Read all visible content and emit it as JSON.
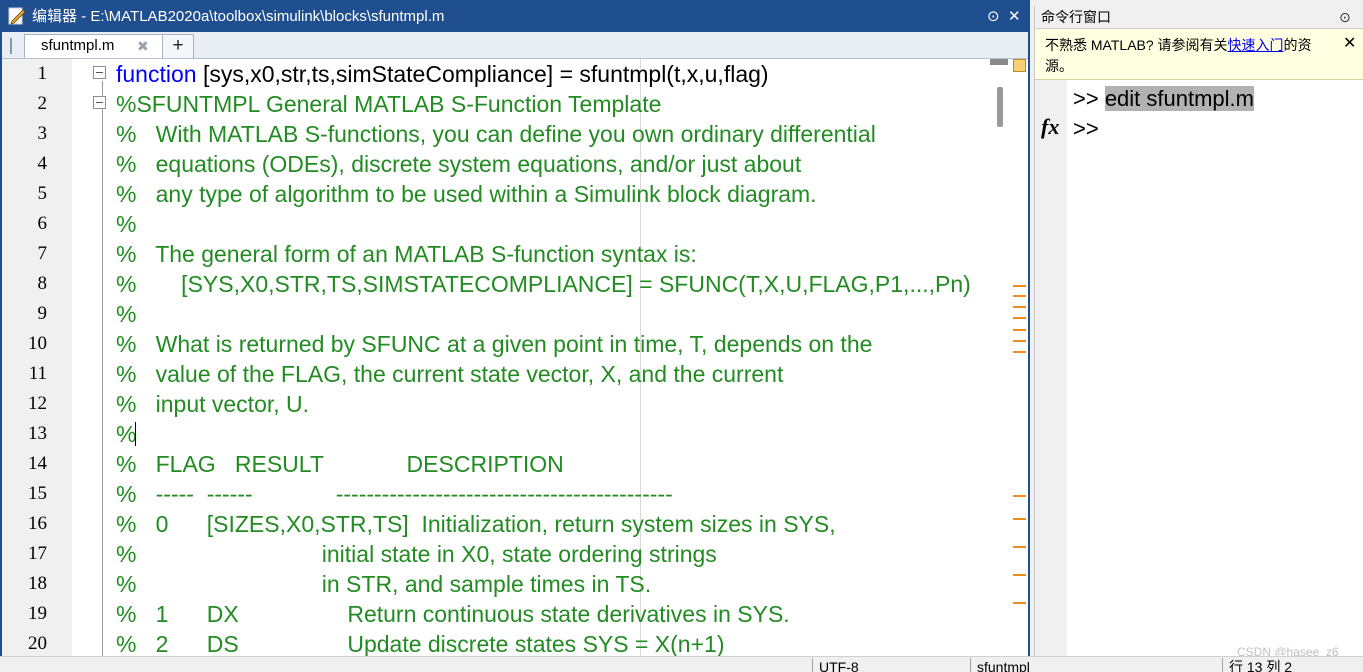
{
  "editor": {
    "title": "编辑器 - E:\\MATLAB2020a\\toolbox\\simulink\\blocks\\sfuntmpl.m",
    "tab_label": "sfuntmpl.m",
    "tab_close": "✖",
    "add_tab": "+",
    "menu_icon": "⊙",
    "close_icon": "✕",
    "lines": [
      {
        "n": "1",
        "kw": "function",
        "rest": " [sys,x0,str,ts,simStateCompliance] = sfuntmpl(t,x,u,flag)",
        "cm": ""
      },
      {
        "n": "2",
        "kw": "",
        "rest": "",
        "cm": "%SFUNTMPL General MATLAB S-Function Template"
      },
      {
        "n": "3",
        "kw": "",
        "rest": "",
        "cm": "%   With MATLAB S-functions, you can define you own ordinary differential"
      },
      {
        "n": "4",
        "kw": "",
        "rest": "",
        "cm": "%   equations (ODEs), discrete system equations, and/or just about"
      },
      {
        "n": "5",
        "kw": "",
        "rest": "",
        "cm": "%   any type of algorithm to be used within a Simulink block diagram."
      },
      {
        "n": "6",
        "kw": "",
        "rest": "",
        "cm": "%"
      },
      {
        "n": "7",
        "kw": "",
        "rest": "",
        "cm": "%   The general form of an MATLAB S-function syntax is:"
      },
      {
        "n": "8",
        "kw": "",
        "rest": "",
        "cm": "%       [SYS,X0,STR,TS,SIMSTATECOMPLIANCE] = SFUNC(T,X,U,FLAG,P1,...,Pn)"
      },
      {
        "n": "9",
        "kw": "",
        "rest": "",
        "cm": "%"
      },
      {
        "n": "10",
        "kw": "",
        "rest": "",
        "cm": "%   What is returned by SFUNC at a given point in time, T, depends on the"
      },
      {
        "n": "11",
        "kw": "",
        "rest": "",
        "cm": "%   value of the FLAG, the current state vector, X, and the current"
      },
      {
        "n": "12",
        "kw": "",
        "rest": "",
        "cm": "%   input vector, U."
      },
      {
        "n": "13",
        "kw": "",
        "rest": "",
        "cm": "%"
      },
      {
        "n": "14",
        "kw": "",
        "rest": "",
        "cm": "%   FLAG   RESULT             DESCRIPTION"
      },
      {
        "n": "15",
        "kw": "",
        "rest": "",
        "cm": "%   -----  ------             --------------------------------------------"
      },
      {
        "n": "16",
        "kw": "",
        "rest": "",
        "cm": "%   0      [SIZES,X0,STR,TS]  Initialization, return system sizes in SYS,"
      },
      {
        "n": "17",
        "kw": "",
        "rest": "",
        "cm": "%                             initial state in X0, state ordering strings"
      },
      {
        "n": "18",
        "kw": "",
        "rest": "",
        "cm": "%                             in STR, and sample times in TS."
      },
      {
        "n": "19",
        "kw": "",
        "rest": "",
        "cm": "%   1      DX                 Return continuous state derivatives in SYS."
      },
      {
        "n": "20",
        "kw": "",
        "rest": "",
        "cm": "%   2      DS                 Update discrete states SYS = X(n+1)"
      }
    ]
  },
  "command_window": {
    "title": "命令行窗口",
    "options_icon": "⊙",
    "banner_prefix": "不熟悉 MATLAB? 请参阅有关",
    "banner_link": "快速入门",
    "banner_suffix": "的资源。",
    "banner_close": "✕",
    "prompt_1": ">> ",
    "command_1": "edit sfuntmpl.m",
    "prompt_2": ">>",
    "fx": "fx"
  },
  "statusbar": {
    "encoding": "UTF-8",
    "file": "sfuntmpl",
    "position": "行  13   列  2"
  },
  "watermark": "CSDN @hasee_z6"
}
